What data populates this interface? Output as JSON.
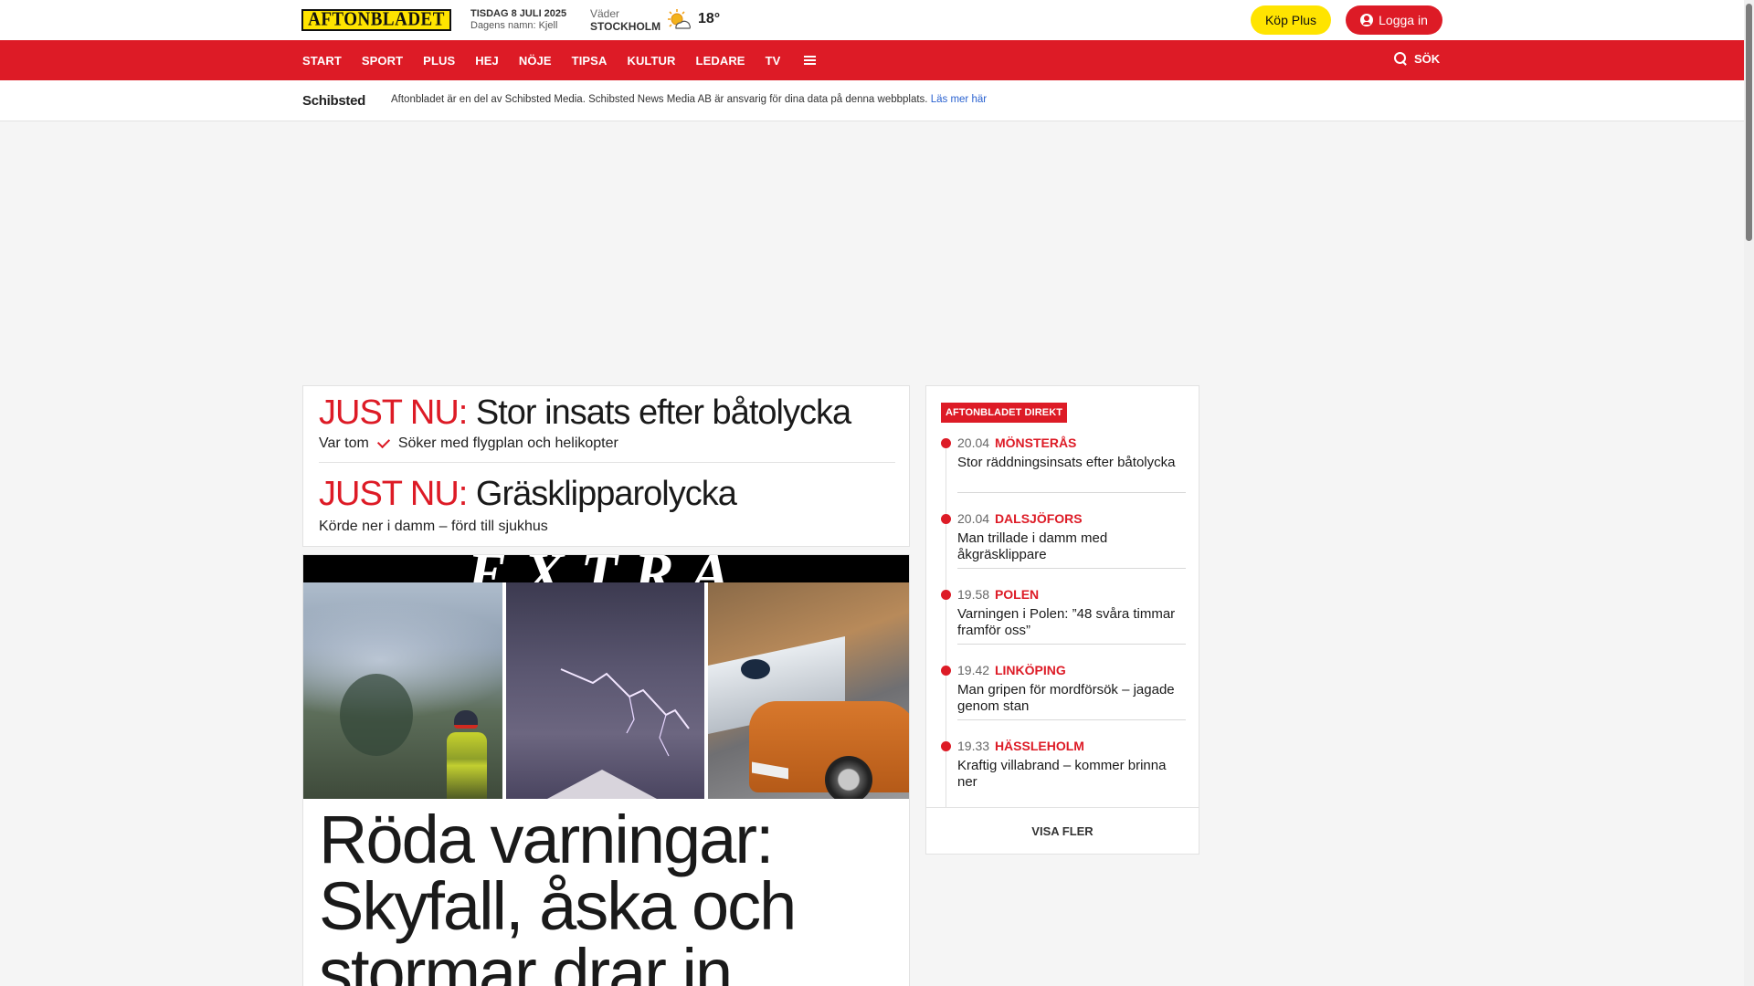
{
  "header": {
    "logo_text": "AFTONBLADET",
    "date": "TISDAG 8 JULI 2025",
    "name_day": "Dagens namn: Kjell",
    "weather_label": "Väder",
    "weather_city": "STOCKHOLM",
    "weather_icon": "sun-cloud-icon",
    "temperature": "18°",
    "plus_button": "Köp Plus",
    "login_button": "Logga in"
  },
  "nav": {
    "items": [
      "START",
      "SPORT",
      "PLUS",
      "HEJ",
      "NÖJE",
      "TIPSA",
      "KULTUR",
      "LEDARE",
      "TV"
    ],
    "search_label": "SÖK"
  },
  "schibsted": {
    "logo": "Schibsted",
    "text": "Aftonbladet är en del av Schibsted Media. Schibsted News Media AB är ansvarig för dina data på denna webbplats.",
    "link": "Läs mer här"
  },
  "just_nu": [
    {
      "prefix": "JUST NU:",
      "title": "Stor insats efter båtolycka",
      "sub_a": "Var tom",
      "sub_b": "Söker med flygplan och helikopter"
    },
    {
      "prefix": "JUST NU:",
      "title": "Gräsklipparolycka",
      "sub": "Körde ner i damm – förd till sjukhus"
    }
  ],
  "hero": {
    "banner": "EXTRA",
    "title": "Röda varningar: Skyfall, åska och stormar drar in"
  },
  "direkt": {
    "badge": "AFTONBLADET DIREKT",
    "items": [
      {
        "time": "20.04",
        "place": "MÖNSTERÅS",
        "headline": "Stor räddningsinsats efter båtolycka"
      },
      {
        "time": "20.04",
        "place": "DALSJÖFORS",
        "headline": "Man trillade i damm med åkgräsklippare"
      },
      {
        "time": "19.58",
        "place": "POLEN",
        "headline": "Varningen i Polen: ”48 svåra timmar framför oss”"
      },
      {
        "time": "19.42",
        "place": "LINKÖPING",
        "headline": "Man gripen för mordförsök – jagade genom stan"
      },
      {
        "time": "19.33",
        "place": "HÄSSLEHOLM",
        "headline": "Kraftig villabrand – kommer brinna ner"
      }
    ],
    "more": "VISA FLER"
  },
  "colors": {
    "brand_red": "#dd1b26",
    "brand_yellow": "#ffe400",
    "link_blue": "#2a62d0"
  }
}
